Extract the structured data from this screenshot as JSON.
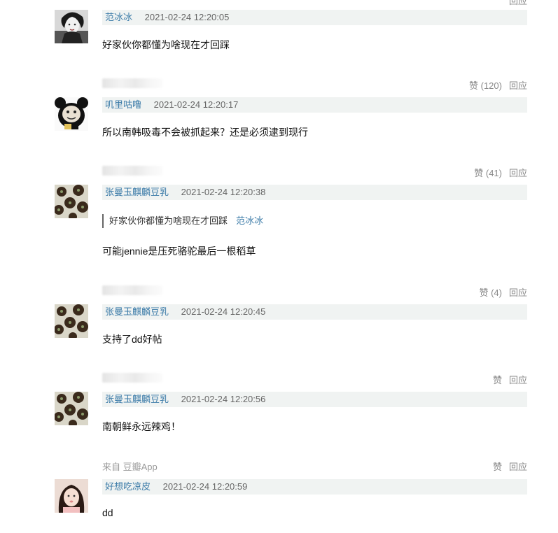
{
  "top_actions": {
    "reply": "回应"
  },
  "comments": [
    {
      "user": "范冰冰",
      "time": "2021-02-24 12:20:05",
      "text": "好家伙你都懂为啥现在才回踩"
    },
    {
      "user": "叽里咕噜",
      "time": "2021-02-24 12:20:17",
      "text": "所以南韩吸毒不会被抓起来？还是必须逮到现行"
    },
    {
      "user": "张曼玉麒麟豆乳",
      "time": "2021-02-24 12:20:38",
      "quote_text": "好家伙你都懂为啥现在才回踩",
      "quote_user": "范冰冰",
      "text": "可能jennie是压死骆驼最后一根稻草"
    },
    {
      "user": "张曼玉麒麟豆乳",
      "time": "2021-02-24 12:20:45",
      "text": "支持了dd好帖"
    },
    {
      "user": "张曼玉麒麟豆乳",
      "time": "2021-02-24 12:20:56",
      "text": "南朝鲜永远辣鸡！"
    },
    {
      "user": "好想吃凉皮",
      "time": "2021-02-24 12:20:59",
      "text": "dd"
    }
  ],
  "meta_rows": [
    {
      "like": "赞 (120)",
      "reply": "回应"
    },
    {
      "like": "赞 (41)",
      "reply": "回应"
    },
    {
      "like": "赞 (4)",
      "reply": "回应"
    },
    {
      "like": "赞",
      "reply": "回应"
    },
    {
      "source": "来自 豆瓣App",
      "like": "赞",
      "reply": "回应"
    }
  ],
  "avatar_kinds": [
    "portrait-icon",
    "panda-meme-icon",
    "flower-pattern-icon",
    "flower-pattern-icon",
    "flower-pattern-icon",
    "girl-portrait-icon"
  ],
  "colors": {
    "username": "#3b7ba8",
    "header_bg": "#f0f3f2",
    "action": "#888888"
  }
}
